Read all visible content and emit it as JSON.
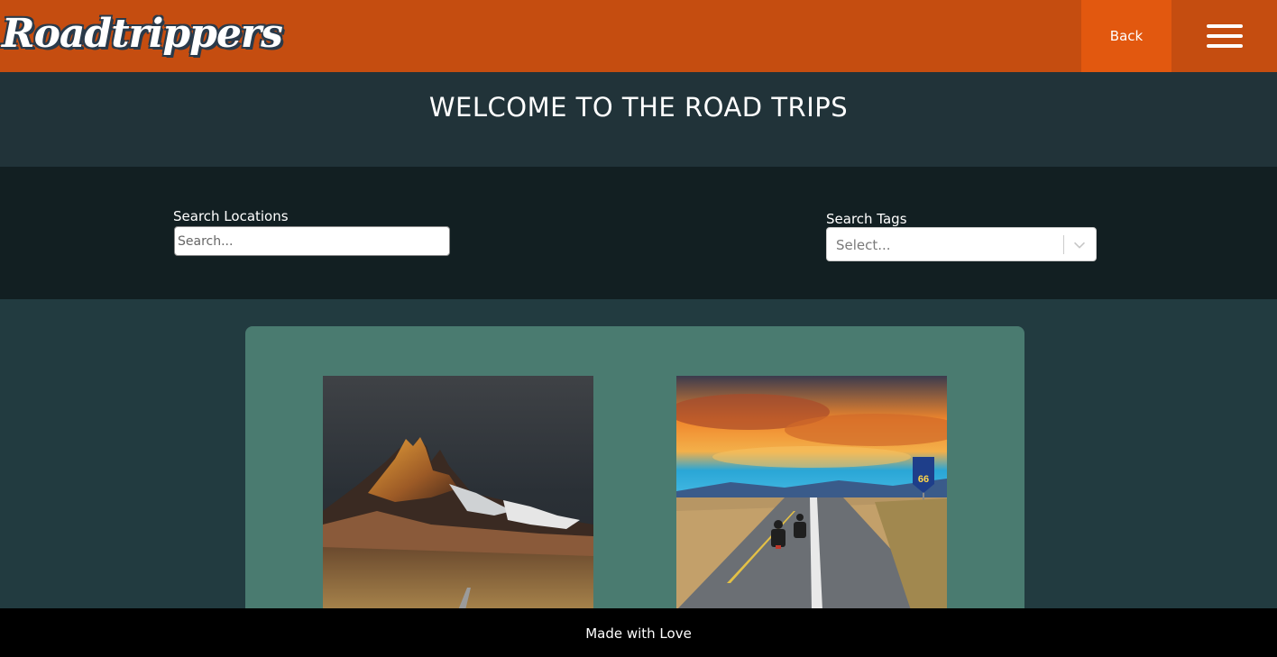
{
  "header": {
    "logo_text": "Roadtrippers",
    "back_label": "Back",
    "menu_icon": "hamburger-menu-icon"
  },
  "welcome": {
    "title": "WELCOME TO THE ROAD TRIPS"
  },
  "search": {
    "locations_label": "Search Locations",
    "locations_placeholder": "Search...",
    "locations_value": "",
    "tags_label": "Search Tags",
    "tags_placeholder": "Select...",
    "tags_icon": "chevron-down-icon"
  },
  "trips": [
    {
      "image": "mountain-landscape-image"
    },
    {
      "image": "route-66-motorcycle-image"
    }
  ],
  "footer": {
    "text": "Made with Love"
  },
  "colors": {
    "header_bg": "#c54d10",
    "back_bg": "#e2580f",
    "page_bg": "#223b40",
    "search_band_bg": "#121f22",
    "card_bg": "#4a7b70",
    "footer_bg": "#000000"
  }
}
